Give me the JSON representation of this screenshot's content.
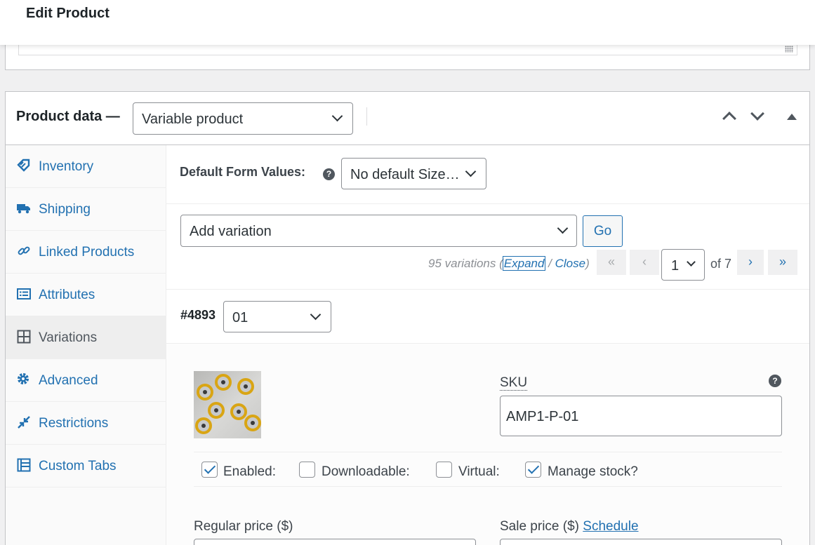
{
  "header": {
    "title": "Edit Product"
  },
  "product_data": {
    "label": "Product data —",
    "type_value": "Variable product"
  },
  "tabs": [
    {
      "label": "Inventory",
      "icon": "tag-icon"
    },
    {
      "label": "Shipping",
      "icon": "truck-icon"
    },
    {
      "label": "Linked Products",
      "icon": "link-icon"
    },
    {
      "label": "Attributes",
      "icon": "list-icon"
    },
    {
      "label": "Variations",
      "icon": "grid-icon",
      "active": true
    },
    {
      "label": "Advanced",
      "icon": "gear-icon"
    },
    {
      "label": "Restrictions",
      "icon": "shrink-icon"
    },
    {
      "label": "Custom Tabs",
      "icon": "tabs-icon"
    }
  ],
  "variations": {
    "default_form_label": "Default Form Values:",
    "default_form_value": "No default Size…",
    "add_variation_value": "Add variation",
    "go_label": "Go",
    "count_text": "95 variations (",
    "expand_label": "Expand",
    "separator": " / ",
    "close_label": "Close",
    "close_paren": ")",
    "pagination": {
      "first": "«",
      "prev": "‹",
      "current": "1",
      "of_text": "of 7",
      "next": "›",
      "last": "»"
    },
    "variation_id": "#4893",
    "variation_value": "01",
    "sku_label": "SKU",
    "sku_value": "AMP1-P-01",
    "options": {
      "enabled": {
        "label": "Enabled:",
        "checked": true
      },
      "downloadable": {
        "label": "Downloadable:",
        "checked": false
      },
      "virtual": {
        "label": "Virtual:",
        "checked": false
      },
      "manage_stock": {
        "label": "Manage stock?",
        "checked": true
      }
    },
    "regular_price_label": "Regular price ($)",
    "sale_price_label": "Sale price ($)",
    "schedule_label": "Schedule"
  },
  "colors": {
    "accent": "#2271b1",
    "border": "#c3c4c7",
    "text": "#3c434a"
  }
}
